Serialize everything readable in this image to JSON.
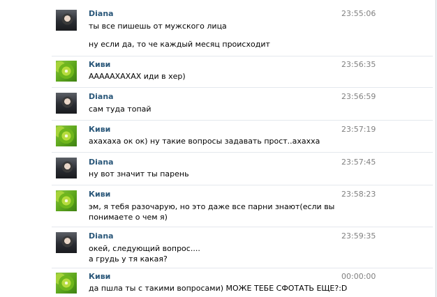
{
  "messages": [
    {
      "author": "Diana",
      "avatar": "diana-photo-avatar",
      "time": "23:55:06",
      "lines": [
        "ты все пишешь от мужского лица",
        "ну если да, то че каждый месяц происходит"
      ]
    },
    {
      "author": "Киви",
      "avatar": "kiwi-photo-avatar",
      "time": "23:56:35",
      "lines": [
        "АААААХАХАХ иди в хер)"
      ]
    },
    {
      "author": "Diana",
      "avatar": "diana-photo-avatar",
      "time": "23:56:59",
      "lines": [
        "сам туда топай"
      ]
    },
    {
      "author": "Киви",
      "avatar": "kiwi-photo-avatar",
      "time": "23:57:19",
      "lines": [
        "ахахаха ок ок) ну такие вопросы задавать прост..ахахха"
      ]
    },
    {
      "author": "Diana",
      "avatar": "diana-photo-avatar",
      "time": "23:57:45",
      "lines": [
        "ну вот значит ты парень"
      ]
    },
    {
      "author": "Киви",
      "avatar": "kiwi-photo-avatar",
      "time": "23:58:23",
      "lines": [
        "эм, я тебя разочарую, но это даже все парни знают(если вы",
        "понимаете о чем я)"
      ]
    },
    {
      "author": "Diana",
      "avatar": "diana-photo-avatar",
      "time": "23:59:35",
      "lines": [
        "окей, следующий вопрос....",
        "а грудь у тя какая?"
      ]
    },
    {
      "author": "Киви",
      "avatar": "kiwi-photo-avatar",
      "time": "00:00:00",
      "lines": [
        "да пшла ты с такими вопросами) МОЖЕ ТЕБЕ СФОТАТЬ ЕЩЕ?:D"
      ]
    }
  ],
  "colors": {
    "author": "#2b587a",
    "time": "#808080",
    "separator": "#e4e8ed"
  }
}
